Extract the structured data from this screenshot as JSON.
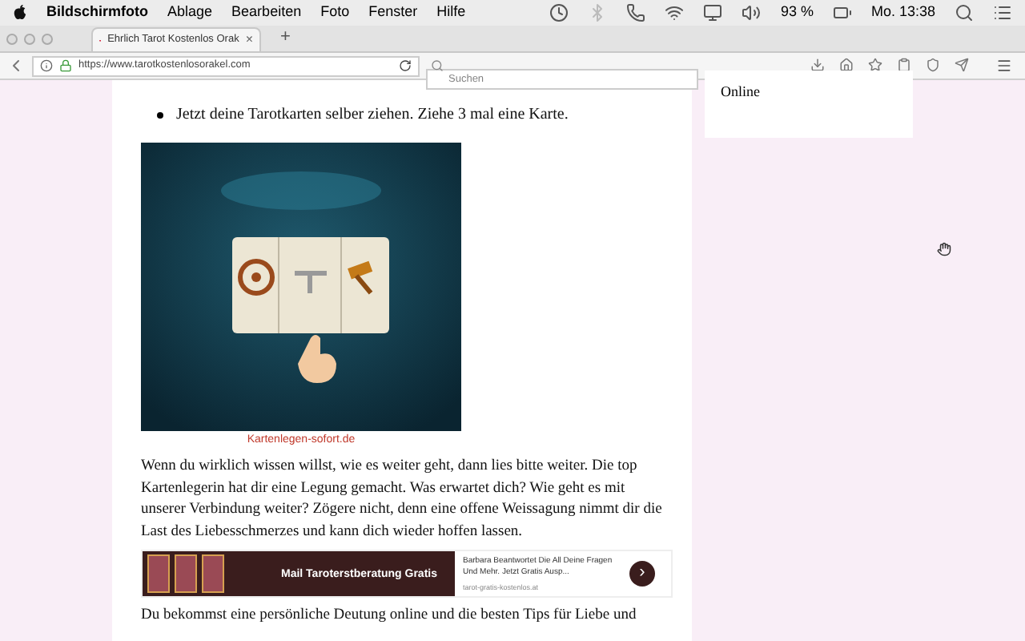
{
  "menu_bar": {
    "app": "Bildschirmfoto",
    "items": [
      "Ablage",
      "Bearbeiten",
      "Foto",
      "Fenster",
      "Hilfe"
    ],
    "battery": "93 %",
    "clock": "Mo. 13:38"
  },
  "tab": {
    "title": "Ehrlich Tarot Kostenlos Orak",
    "close": "×",
    "new_tab": "+"
  },
  "toolbar": {
    "url": "https://www.tarotkostenlosorakel.com",
    "search": {
      "placeholder": "Suchen"
    }
  },
  "article": {
    "bullet": "Jetzt deine Tarotkarten selber ziehen. Ziehe 3 mal eine Karte.",
    "image": {
      "kind": "picture",
      "caption": "Kartenlegen-sofort.de"
    },
    "paragraph": "Wenn du wirklich wissen willst, wie es weiter geht, dann lies bitte weiter. Die top Kartenlegerin hat dir eine Legung gemacht. Was erwartet dich? Wie geht es mit unserer Verbindung weiter? Zögere nicht, denn eine offene Weissagung nimmt dir die Last des Liebesschmerzes und kann dich wieder hoffen lassen.",
    "ad": {
      "banner": "Mail Taroterstberatung Gratis",
      "text": "Barbara Beantwortet Die All Deine Fragen Und Mehr. Jetzt Gratis Ausp...",
      "domain": "tarot-gratis-kostenlos.at",
      "arrow": "›"
    },
    "paragraph_2": "Du bekommst eine persönliche Deutung online und die besten Tips für Liebe und"
  },
  "sidebar": {
    "text": "Online"
  }
}
